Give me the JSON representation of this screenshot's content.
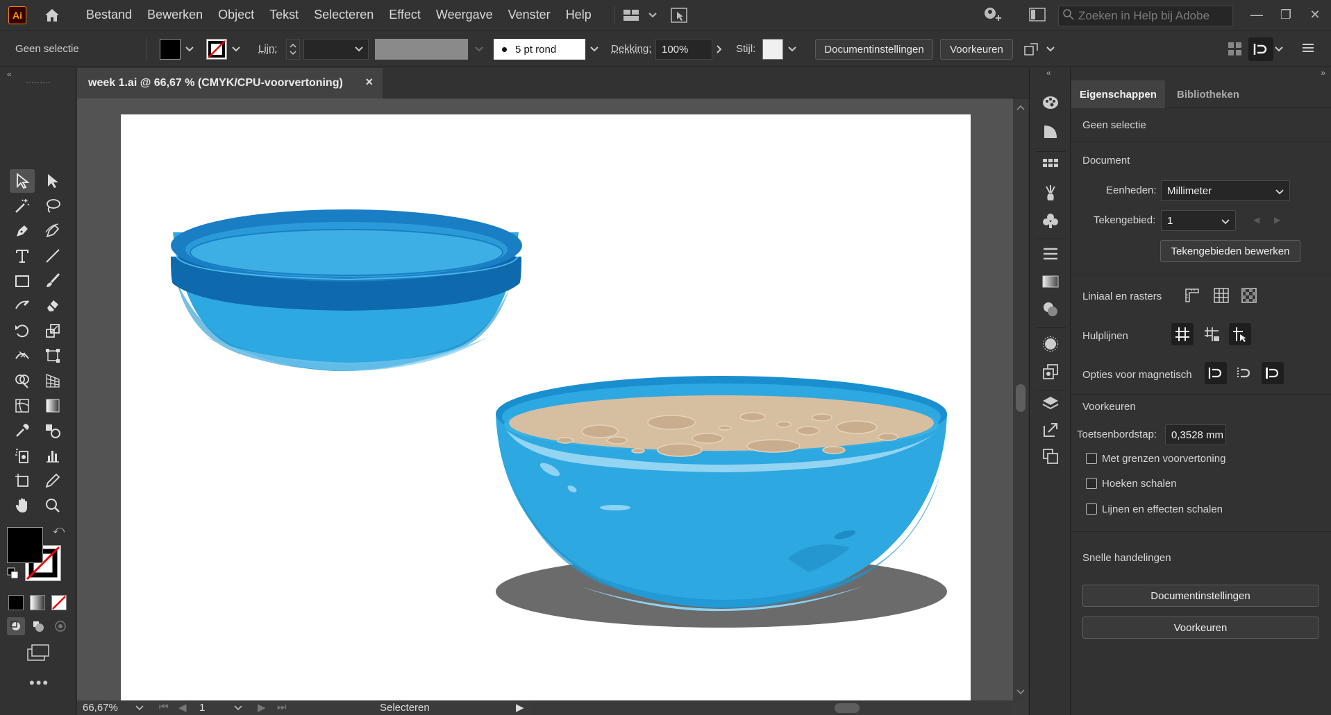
{
  "app": {
    "logo_text": "Ai",
    "menus": [
      "Bestand",
      "Bewerken",
      "Object",
      "Tekst",
      "Selecteren",
      "Effect",
      "Weergave",
      "Venster",
      "Help"
    ],
    "help_search_placeholder": "Zoeken in Help bij Adobe"
  },
  "control_bar": {
    "selection_label": "Geen selectie",
    "stroke_label": "Lijn:",
    "brush_label": "5 pt rond",
    "opacity_label": "Dekking:",
    "opacity_value": "100%",
    "style_label": "Stijl:",
    "doc_settings_button": "Documentinstellingen",
    "preferences_button": "Voorkeuren"
  },
  "document": {
    "tab_title": "week 1.ai @ 66,67 % (CMYK/CPU-voorvertoning)",
    "close_glyph": "×"
  },
  "status_bar": {
    "zoom": "66,67%",
    "artboard_number": "1",
    "tool_status": "Selecteren"
  },
  "properties_panel": {
    "tabs": [
      "Eigenschappen",
      "Bibliotheken"
    ],
    "selection_state": "Geen selectie",
    "document_section": "Document",
    "units_label": "Eenheden:",
    "units_value": "Millimeter",
    "artboard_label": "Tekengebied:",
    "artboard_value": "1",
    "edit_artboards_button": "Tekengebieden bewerken",
    "rulers_label": "Liniaal en rasters",
    "guides_label": "Hulplijnen",
    "snap_label": "Opties voor magnetisch",
    "preferences_section": "Voorkeuren",
    "keyboard_increment_label": "Toetsenbordstap:",
    "keyboard_increment_value": "0,3528 mm",
    "checkboxes": [
      "Met grenzen voorvertoning",
      "Hoeken schalen",
      "Lijnen en effecten schalen"
    ],
    "quick_actions_label": "Snelle handelingen",
    "doc_settings_button": "Documentinstellingen",
    "preferences_button": "Voorkeuren"
  },
  "colors": {
    "ui_dark": "#323232",
    "canvas_bg": "#535353",
    "bowl_blue": "#2ea8e0",
    "bowl_rim": "#1a7ec4",
    "bowl_rim_dark": "#0f69ad",
    "soup": "#d6bea0",
    "shadow": "#6b6b6b"
  }
}
